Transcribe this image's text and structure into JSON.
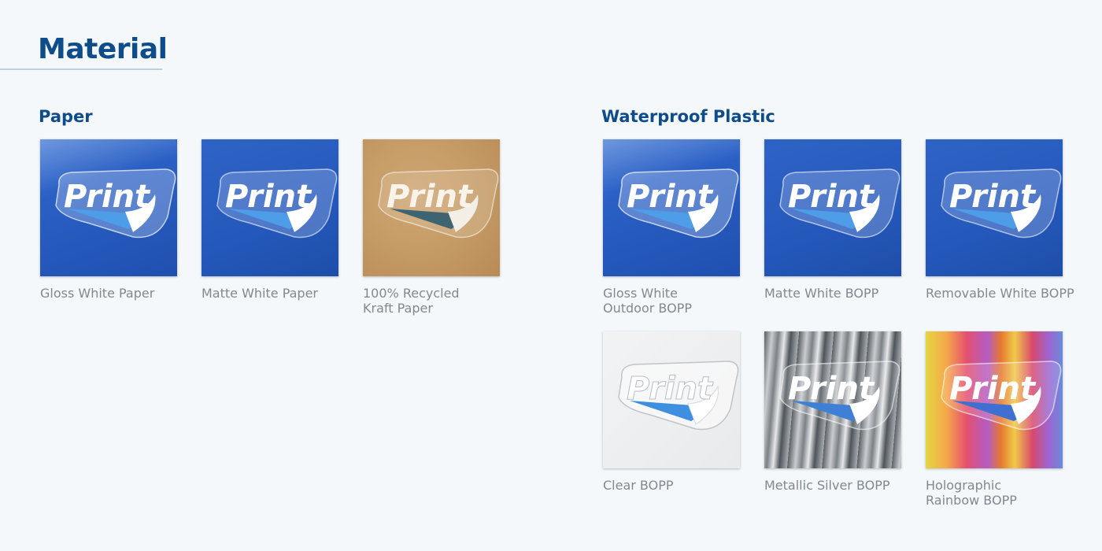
{
  "page": {
    "title": "Material"
  },
  "sections": {
    "paper": {
      "title": "Paper",
      "items": [
        {
          "lines": [
            "Gloss White Paper"
          ]
        },
        {
          "lines": [
            "Matte White Paper"
          ]
        },
        {
          "lines": [
            "100% Recycled",
            "Kraft Paper"
          ]
        }
      ]
    },
    "plastic": {
      "title": "Waterproof Plastic",
      "items": [
        {
          "lines": [
            "Gloss White",
            "Outdoor BOPP"
          ]
        },
        {
          "lines": [
            "Matte White BOPP"
          ]
        },
        {
          "lines": [
            "Removable White BOPP"
          ]
        },
        {
          "lines": [
            "Clear BOPP"
          ]
        },
        {
          "lines": [
            "Metallic Silver BOPP"
          ]
        },
        {
          "lines": [
            "Holographic",
            "Rainbow BOPP"
          ]
        }
      ]
    }
  },
  "sticker": {
    "logo_text": "Print"
  },
  "colors": {
    "heading": "#0f4c8a",
    "label": "#808890",
    "background": "#f4f8fb",
    "brand_blue": "#2a5fc4"
  }
}
